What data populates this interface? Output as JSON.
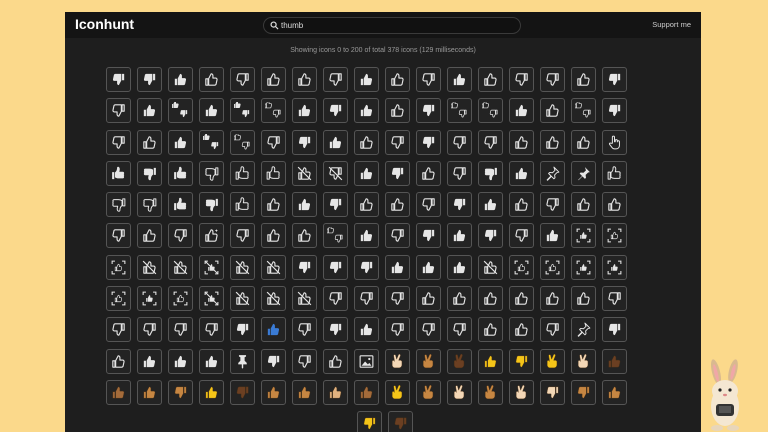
{
  "app": {
    "logo": "Iconhunt",
    "support_label": "Support me"
  },
  "search": {
    "value": "thumb",
    "icon": "search-icon"
  },
  "status": "Showing icons 0 to 200 of total 378 icons (129 milliseconds)",
  "colors": {
    "page_bg": "#fbd98b",
    "panel_bg": "#1e1e1e",
    "topbar_bg": "#141414",
    "tile_border": "#555555",
    "emoji_yellow": "#f5c518"
  },
  "icon_rows": [
    [
      "thumb-down-solid",
      "thumb-down-solid",
      "thumb-up-solid",
      "thumb-up-outline",
      "thumb-down-outline",
      "thumb-up-outline",
      "thumb-up-outline",
      "thumb-down-outline",
      "thumb-up-solid",
      "thumb-up-outline",
      "thumb-down-outline",
      "thumb-up-solid",
      "thumb-up-outline",
      "thumb-down-outline",
      "thumb-down-outline",
      "thumb-up-outline",
      "thumb-down-solid"
    ],
    [
      "thumb-down-outline",
      "thumb-up-solid",
      "thumbs-up-down-solid",
      "thumb-up-solid",
      "thumbs-up-down-solid",
      "thumbs-up-down-outline",
      "thumb-up-solid",
      "thumb-down-solid",
      "thumb-up-solid",
      "thumb-up-outline",
      "thumb-down-solid",
      "thumbs-up-down-outline",
      "thumbs-up-down-outline",
      "thumb-up-solid",
      "thumb-up-outline",
      "thumbs-up-down-outline",
      "thumb-down-solid"
    ],
    [
      "thumb-down-outline",
      "thumb-up-outline",
      "thumb-up-solid",
      "thumbs-up-down-solid",
      "thumbs-up-down-outline",
      "thumb-down-outline",
      "thumb-down-solid",
      "thumb-up-solid",
      "thumb-up-outline",
      "thumb-down-outline",
      "thumb-down-solid",
      "thumb-down-outline",
      "thumb-down-outline",
      "thumb-up-outline",
      "thumb-up-outline",
      "thumb-up-outline",
      "hand-pointer-icon"
    ],
    [
      "hand-thumb-up-solid",
      "hand-thumb-down-solid",
      "hand-thumb-up-solid",
      "hand-thumb-down-outline",
      "hand-thumb-up-outline",
      "hand-thumb-up-outline",
      "thumb-up-off-icon",
      "thumb-down-off-icon",
      "thumb-up-solid",
      "thumb-down-solid",
      "thumb-up-outline",
      "thumb-down-outline",
      "hand-thumb-down-solid",
      "thumb-up-solid",
      "pin-outline",
      "pin-solid",
      "hand-thumb-up-outline"
    ],
    [
      "hand-thumb-down-outline",
      "hand-thumb-down-outline",
      "hand-thumb-up-solid",
      "hand-thumb-down-solid",
      "hand-thumb-up-outline",
      "thumb-up-outline",
      "thumb-up-solid",
      "thumb-down-solid",
      "thumb-up-outline",
      "thumb-up-outline",
      "thumb-down-outline",
      "thumb-down-solid",
      "thumb-up-solid",
      "thumb-up-outline",
      "thumb-down-outline",
      "thumb-up-outline",
      "thumb-up-outline"
    ],
    [
      "thumb-down-outline",
      "thumb-up-outline",
      "thumb-down-outline",
      "thumb-up-sparkle-icon",
      "thumb-down-outline",
      "thumb-up-outline",
      "thumb-up-outline",
      "thumbs-up-down-outline",
      "thumb-up-solid",
      "thumb-down-outline",
      "thumb-down-solid",
      "thumb-up-solid",
      "thumb-down-solid",
      "thumb-down-outline",
      "thumb-up-solid",
      "thumb-focus-icon",
      "thumb-focus-outline-icon"
    ],
    [
      "thumb-focus-outline-icon",
      "thumb-off-icon",
      "thumb-off-icon",
      "thumb-off-focus-icon",
      "thumb-off-icon",
      "thumb-off-icon",
      "thumb-down-solid",
      "thumb-down-solid",
      "thumb-down-solid",
      "thumb-up-solid",
      "thumb-up-solid",
      "thumb-up-solid",
      "thumb-off-icon",
      "thumb-focus-outline-icon",
      "thumb-focus-outline-icon",
      "thumb-focus-icon",
      "thumb-focus-icon"
    ],
    [
      "thumb-focus-outline-icon",
      "thumb-focus-icon",
      "thumb-focus-outline-icon",
      "thumb-off-focus-icon",
      "thumb-off-icon",
      "thumb-off-icon",
      "thumb-off-icon",
      "thumb-down-outline",
      "thumb-down-outline",
      "thumb-down-outline",
      "thumb-up-outline",
      "thumb-up-outline",
      "thumb-up-outline",
      "thumb-up-outline",
      "thumb-up-outline",
      "thumb-up-outline",
      "thumb-down-outline"
    ],
    [
      "thumb-down-outline",
      "thumb-down-outline",
      "thumb-down-outline",
      "thumb-down-outline",
      "thumb-down-solid",
      "thumb-up-blue-icon",
      "thumb-down-outline",
      "thumb-down-solid",
      "thumb-up-solid",
      "thumb-down-outline",
      "thumb-down-outline",
      "thumb-down-outline",
      "thumb-up-outline",
      "thumb-up-outline",
      "thumb-down-outline",
      "pin-outline",
      "thumb-down-solid"
    ],
    [
      "thumb-up-outline",
      "thumb-up-solid",
      "thumb-up-solid",
      "thumb-up-solid",
      "pushpin-icon",
      "thumb-down-solid",
      "thumb-down-outline",
      "thumb-up-outline",
      "image-icon",
      "crossed-fingers-light-emoji",
      "crossed-fingers-medium-emoji",
      "crossed-fingers-dark-emoji",
      "thumbs-up-yellow-emoji",
      "thumbs-down-yellow-emoji",
      "crossed-fingers-yellow-emoji",
      "crossed-fingers-light-emoji",
      "thumbs-up-dark-emoji"
    ],
    [
      "thumbs-up-medium-dark-emoji",
      "thumbs-up-medium-emoji",
      "thumbs-down-medium-emoji",
      "thumbs-up-yellow-emoji",
      "thumbs-down-dark-emoji",
      "thumbs-up-medium-emoji",
      "thumbs-up-medium-emoji",
      "thumbs-up-medium-light-emoji",
      "thumbs-up-medium-dark-emoji",
      "crossed-fingers-yellow-emoji",
      "crossed-fingers-medium-emoji",
      "crossed-fingers-light-emoji",
      "crossed-fingers-medium-emoji",
      "crossed-fingers-light-emoji",
      "thumbs-down-light-emoji",
      "thumbs-down-medium-emoji",
      "thumbs-up-medium-emoji"
    ],
    [
      "thumbs-down-yellow-emoji",
      "thumbs-down-dark-emoji"
    ]
  ],
  "mascot": {
    "icon": "rabbit-mascot-icon"
  }
}
